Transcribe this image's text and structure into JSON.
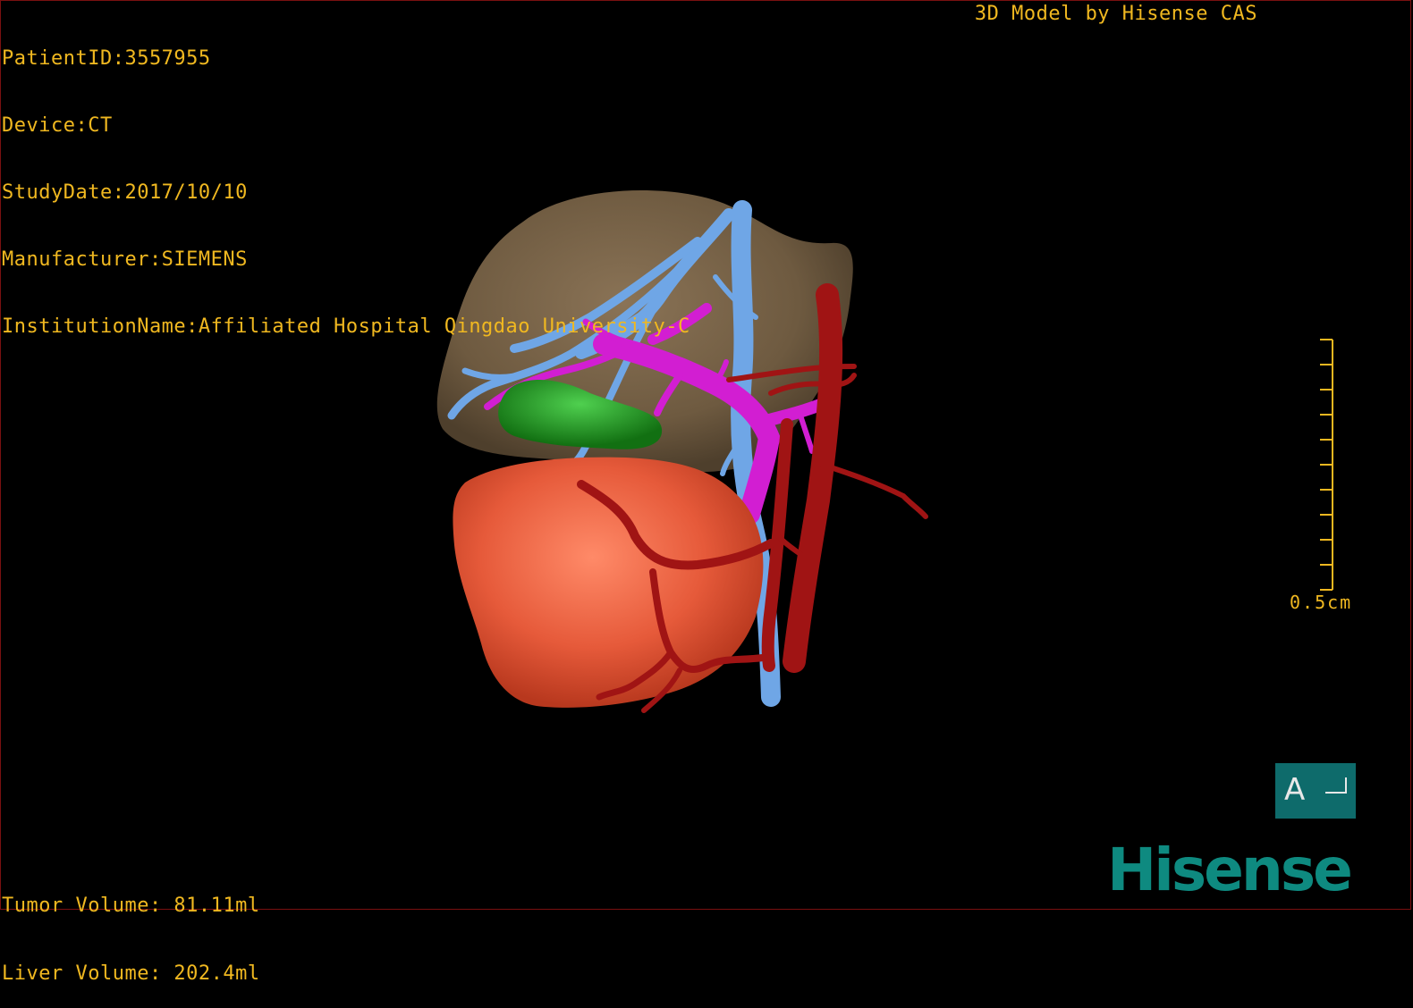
{
  "patient_info": {
    "patient_id": "PatientID:3557955",
    "device": "Device:CT",
    "study_date": "StudyDate:2017/10/10",
    "manufacturer": "Manufacturer:SIEMENS",
    "institution": "InstitutionName:Affiliated Hospital Qingdao University-C"
  },
  "model_credit": "3D Model by Hisense CAS",
  "volumes": {
    "tumor": "Tumor Volume: 81.11ml",
    "liver": "Liver Volume: 202.4ml"
  },
  "scale_bar": {
    "label": "0.5cm",
    "ticks": 10
  },
  "orientation": {
    "letter": "A"
  },
  "logo": "Hisense",
  "colors": {
    "overlay_text": "#f0b820",
    "liver": "#7a6448",
    "tumor": "#e65a3a",
    "gallbladder": "#1fa01f",
    "hepatic_vein": "#6fa6e6",
    "portal_vein": "#d21ed2",
    "artery": "#a01414",
    "orientation_box": "#0e6b6b",
    "logo": "#0e8a80"
  },
  "structures": [
    "liver",
    "tumor",
    "gallbladder",
    "hepatic-vein",
    "portal-vein",
    "artery"
  ]
}
